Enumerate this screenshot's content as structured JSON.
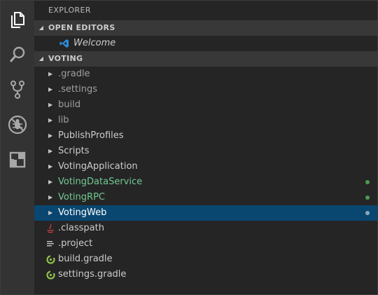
{
  "activity_bar": {
    "items": [
      {
        "icon": "files-icon"
      },
      {
        "icon": "search-icon"
      },
      {
        "icon": "source-control-icon"
      },
      {
        "icon": "debug-icon"
      },
      {
        "icon": "extensions-icon"
      }
    ]
  },
  "sidebar": {
    "title": "EXPLORER",
    "open_editors": {
      "header": "OPEN EDITORS",
      "items": [
        {
          "label": "Welcome",
          "icon": "vscode-icon"
        }
      ]
    },
    "project": {
      "header": "VOTING",
      "folders": [
        {
          "label": ".gradle"
        },
        {
          "label": ".settings"
        },
        {
          "label": "build"
        },
        {
          "label": "lib"
        },
        {
          "label": "PublishProfiles"
        },
        {
          "label": "Scripts"
        },
        {
          "label": "VotingApplication"
        },
        {
          "label": "VotingDataService"
        },
        {
          "label": "VotingRPC"
        },
        {
          "label": "VotingWeb"
        }
      ],
      "files": [
        {
          "label": ".classpath",
          "icon": "java-icon"
        },
        {
          "label": ".project",
          "icon": "lines-file-icon"
        },
        {
          "label": "build.gradle",
          "icon": "gradle-icon"
        },
        {
          "label": "settings.gradle",
          "icon": "gradle-icon"
        }
      ]
    }
  },
  "colors": {
    "activity_bar": "#333333",
    "sidebar": "#252526",
    "section_header": "#383838",
    "selection": "#094771",
    "git_modified": "#73c991",
    "vscode_blue": "#2a8ddb",
    "gradle_green": "#8dc149",
    "java_red": "#cc3e44"
  }
}
